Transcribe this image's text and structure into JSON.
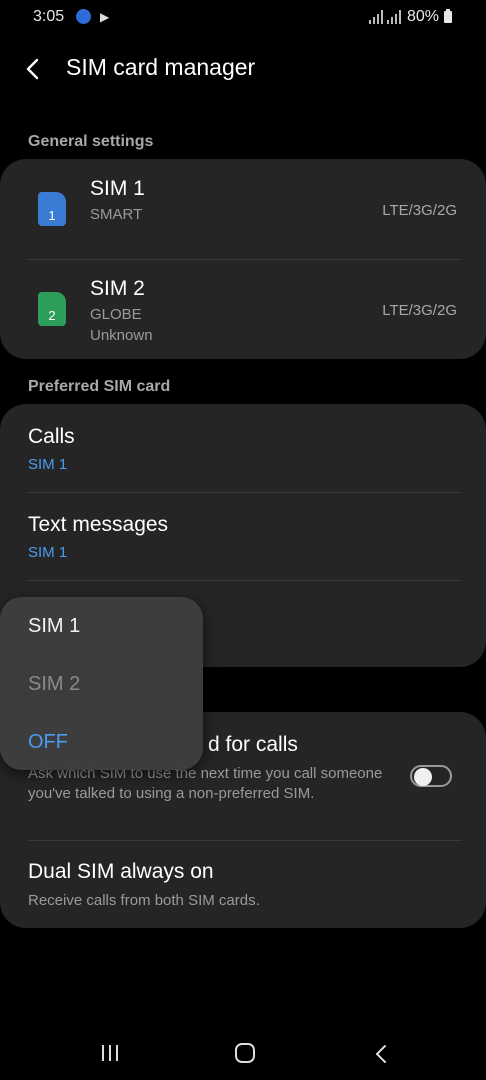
{
  "status_bar": {
    "time": "3:05",
    "battery": "80%",
    "icons": [
      "cloud-sync-icon",
      "play-icon",
      "signal-icon",
      "signal-icon",
      "battery-icon"
    ]
  },
  "header": {
    "title": "SIM card manager",
    "back_icon": "chevron-left-icon"
  },
  "general": {
    "label": "General settings",
    "sims": [
      {
        "name": "SIM 1",
        "carrier": "SMART",
        "status": "",
        "network": "LTE/3G/2G",
        "slot": "1",
        "color": "#3a7bd5"
      },
      {
        "name": "SIM 2",
        "carrier": "GLOBE",
        "status": "Unknown",
        "network": "LTE/3G/2G",
        "slot": "2",
        "color": "#2e9e5b"
      }
    ]
  },
  "preferred": {
    "label": "Preferred SIM card",
    "items": [
      {
        "title": "Calls",
        "value": "SIM 1"
      },
      {
        "title": "Text messages",
        "value": "SIM 1"
      }
    ]
  },
  "popup": {
    "options": [
      {
        "label": "SIM 1",
        "state": "normal"
      },
      {
        "label": "SIM 2",
        "state": "disabled"
      },
      {
        "label": "OFF",
        "state": "selected"
      }
    ]
  },
  "more": {
    "confirm_title_visible": "d for calls",
    "confirm_desc": "Ask which SIM to use the next time you call someone you've talked to using a non-preferred SIM.",
    "confirm_toggle_on": false,
    "dual_title": "Dual SIM always on",
    "dual_desc": "Receive calls from both SIM cards."
  },
  "colors": {
    "accent": "#4b9bf2",
    "card": "#252525",
    "background": "#000000"
  }
}
